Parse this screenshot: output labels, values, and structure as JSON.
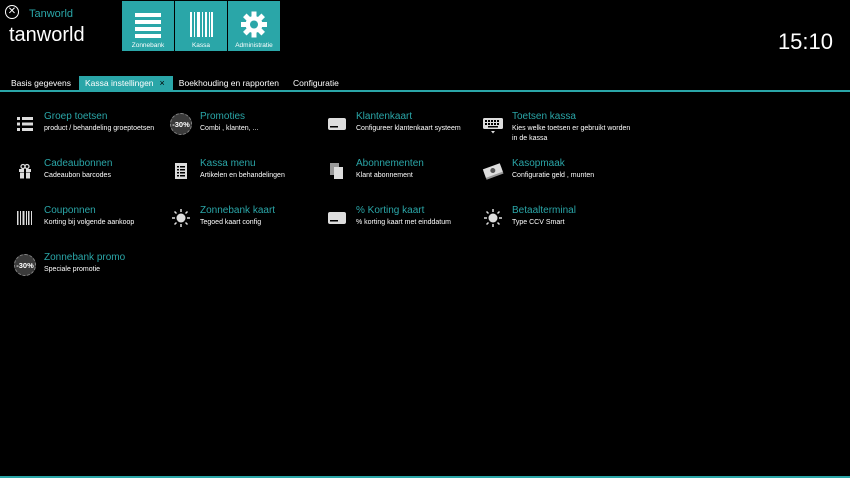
{
  "app": {
    "label": "Tanworld",
    "title": "tanworld",
    "clock": "15:10"
  },
  "modules": [
    {
      "label": "Zonnebank"
    },
    {
      "label": "Kassa"
    },
    {
      "label": "Administratie"
    }
  ],
  "tabs": [
    {
      "label": "Basis gegevens"
    },
    {
      "label": "Kassa instellingen",
      "close": "×"
    },
    {
      "label": "Boekhouding en rapporten"
    },
    {
      "label": "Configuratie"
    }
  ],
  "items": [
    {
      "title": "Groep toetsen",
      "desc": "product / behandeling groeptoetsen",
      "icon": "list-icon"
    },
    {
      "title": "Promoties",
      "desc": "Combi , klanten, ...",
      "icon": "discount-badge-icon",
      "badge": "-30%"
    },
    {
      "title": "Klantenkaart",
      "desc": "Configureer klantenkaart systeem",
      "icon": "card-icon"
    },
    {
      "title": "Toetsen  kassa",
      "desc": "Kies welke toetsen er gebruikt worden in de kassa",
      "icon": "keyboard-icon"
    },
    {
      "title": "Cadeaubonnen",
      "desc": "Cadeaubon barcodes",
      "icon": "gift-icon"
    },
    {
      "title": "Kassa menu",
      "desc": "Artikelen en behandelingen",
      "icon": "menu-icon"
    },
    {
      "title": "Abonnementen",
      "desc": "Klant abonnement",
      "icon": "copy-icon"
    },
    {
      "title": "Kasopmaak",
      "desc": "Configuratie geld , munten",
      "icon": "money-icon"
    },
    {
      "title": "Couponnen",
      "desc": "Korting bij volgende aankoop",
      "icon": "barcode-icon"
    },
    {
      "title": "Zonnebank kaart",
      "desc": "Tegoed kaart config",
      "icon": "sun-icon"
    },
    {
      "title": "% Korting kaart",
      "desc": "% korting kaart met einddatum",
      "icon": "card-icon"
    },
    {
      "title": "Betaalterminal",
      "desc": "Type CCV Smart",
      "icon": "sun-icon"
    },
    {
      "title": "Zonnebank promo",
      "desc": "Speciale promotie",
      "icon": "discount-badge-icon",
      "badge": "-30%"
    }
  ],
  "colors": {
    "accent": "#2aa6a8",
    "background": "#000000"
  }
}
